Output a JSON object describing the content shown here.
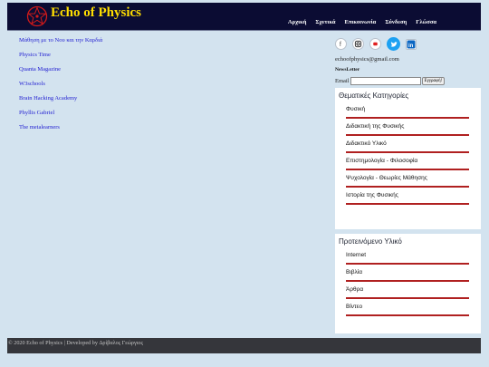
{
  "header": {
    "site_title": "Echo of Physics",
    "nav": [
      "Αρχική",
      "Σχετικά",
      "Επικοινωνία",
      "Σύνδεση",
      "Γλώσσα"
    ]
  },
  "links": [
    "Μάθηση με το Νου και την Καρδιά",
    "Physics Time",
    "Quanta Magazine",
    "W3schools",
    "Brain Hacking Academy",
    "Phyllis Gabriel",
    "The metalearners"
  ],
  "social": {
    "icons": [
      "facebook-icon",
      "instagram-icon",
      "youtube-icon",
      "twitter-icon",
      "linkedin-icon"
    ]
  },
  "contact": {
    "email": "echoofphysics@gmail.com",
    "newsletter_title": "NewsLetter",
    "email_label": "Email",
    "subscribe_label": "Εγγραφή!"
  },
  "categories": {
    "title": "Θεματικές Κατηγορίες",
    "items": [
      "Φυσική",
      "Διδακτική της Φυσικής",
      "Διδακτικό Υλικό",
      "Επιστημολογία - Φιλοσοφία",
      "Ψυχολογία - Θεωρίες Μάθησης",
      "Ιστορία της Φυσικής"
    ]
  },
  "recommended": {
    "title": "Προτεινόμενο Υλικό",
    "items": [
      "Internet",
      "Βιβλία",
      "Άρθρα",
      "Βίντεο"
    ]
  },
  "footer": {
    "text": "© 2020 Echo of Physics | Developed by Δρίβαλος Γεώργιος"
  },
  "colors": {
    "header_bg": "#0b0c33",
    "title_yellow": "#ffde00",
    "accent_red": "#b02020",
    "link_blue": "#1f1cd1",
    "page_bg": "#d3e3ef",
    "footer_bg": "#35363b"
  }
}
